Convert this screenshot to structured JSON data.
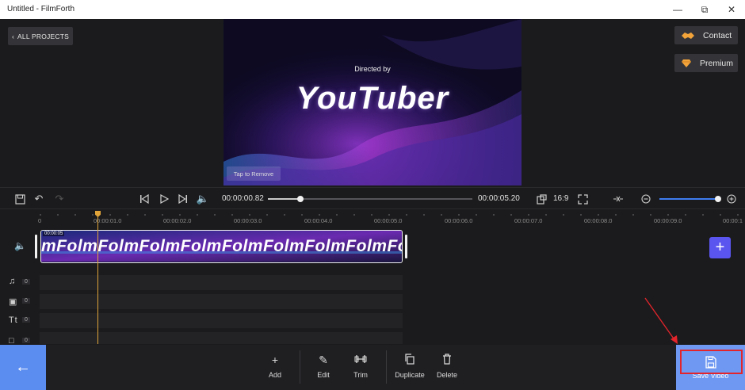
{
  "window": {
    "title": "Untitled - FilmForth",
    "minimize_icon": "minimize-icon",
    "maximize_icon": "maximize-icon",
    "close_icon": "close-icon"
  },
  "header": {
    "all_projects_label": "ALL PROJECTS",
    "contact_label": "Contact",
    "premium_label": "Premium"
  },
  "preview": {
    "directed_by": "Directed by",
    "headline": "YouTuber",
    "tap_to_remove": "Tap to Remove"
  },
  "player": {
    "current_time": "00:00:00.82",
    "total_time": "00:00:05.20",
    "progress": 0.16,
    "aspect_ratio": "16:9",
    "zoom_level": 1.0
  },
  "timeline": {
    "ruler_labels": [
      "0",
      "00:00:01.0",
      "00:00:02.0",
      "00:00:03.0",
      "00:00:04.0",
      "00:00:05.0",
      "00:00:06.0",
      "00:00:07.0",
      "00:00:08.0",
      "00:00:09.0",
      "00:00:1"
    ],
    "clip_time": "00:00:05",
    "clip_text": "mFolmFolmFolmFolmFolmFolmFolmFolmFolmFolm",
    "tracks": [
      {
        "icon": "music-icon",
        "count": "0"
      },
      {
        "icon": "sticker-icon",
        "count": "0"
      },
      {
        "icon": "text-icon",
        "count": "0"
      },
      {
        "icon": "subtitle-icon",
        "count": "0"
      }
    ]
  },
  "toolbar": {
    "add_label": "Add",
    "edit_label": "Edit",
    "trim_label": "Trim",
    "duplicate_label": "Duplicate",
    "delete_label": "Delete",
    "save_video_label": "Save Video"
  },
  "colors": {
    "accent": "#5b8cf0",
    "save_button": "#6e98f2",
    "highlight": "#e3242b",
    "playhead": "#e0a43a",
    "add_track": "#5b55f0"
  }
}
